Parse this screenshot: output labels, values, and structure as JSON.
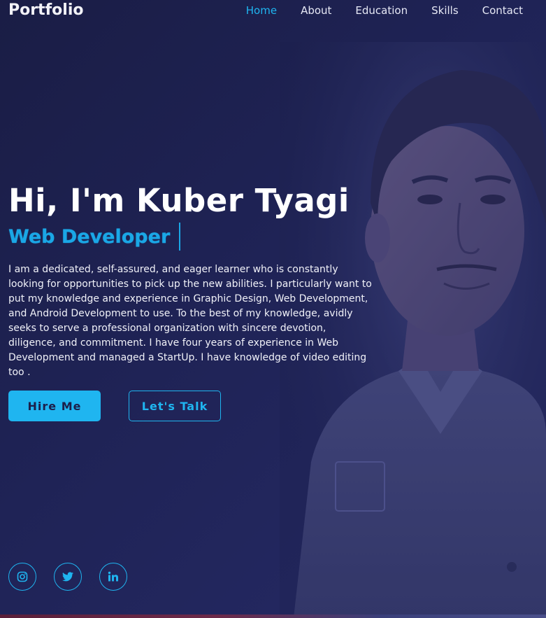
{
  "header": {
    "logo": "Portfolio",
    "nav": [
      {
        "label": "Home",
        "active": true
      },
      {
        "label": "About",
        "active": false
      },
      {
        "label": "Education",
        "active": false
      },
      {
        "label": "Skills",
        "active": false
      },
      {
        "label": "Contact",
        "active": false
      }
    ]
  },
  "hero": {
    "greeting": "Hi, I'm Kuber Tyagi",
    "role": "Web Developer",
    "bio": "I am a dedicated, self-assured, and eager learner who is constantly looking for opportunities to pick up the new abilities. I particularly want to put my knowledge and experience in Graphic Design, Web Development, and Android Development to use. To the best of my knowledge, avidly seeks to serve a professional organization with sincere devotion, diligence, and commitment. I have four years of experience in Web Development and managed a StartUp. I have knowledge of video editing too .",
    "buttons": {
      "hire": "Hire Me",
      "talk": "Let's Talk"
    }
  },
  "social": [
    {
      "icon": "instagram-icon"
    },
    {
      "icon": "twitter-icon"
    },
    {
      "icon": "linkedin-icon"
    }
  ],
  "colors": {
    "background": "#1c1f4a",
    "accent": "#1fb5f0",
    "text": "#ffffff"
  }
}
